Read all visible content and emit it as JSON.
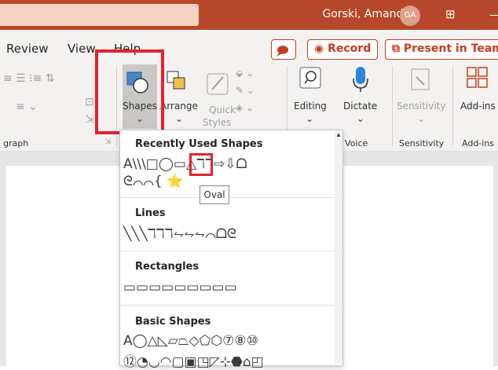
{
  "titlebar": {
    "user_name": "Gorski, Amanda",
    "avatar_initials": "GA",
    "accent": "#b7472a"
  },
  "menu": {
    "items": [
      "Review",
      "View",
      "Help"
    ],
    "record_label": "Record",
    "present_label": "Present in Teams"
  },
  "ribbon": {
    "group_paragraph": "graph",
    "shapes_label": "Shapes",
    "arrange_label": "Arrange",
    "quick_styles_label_1": "Quick",
    "quick_styles_label_2": "Styles",
    "editing_label": "Editing",
    "dictate_label": "Dictate",
    "sensitivity_label": "Sensitivity",
    "addins_label": "Add-ins",
    "group_voice": "Voice",
    "group_sensitivity": "Sensitivity",
    "group_addins": "Add-ins"
  },
  "dropdown": {
    "recent_header": "Recently Used Shapes",
    "recent_row_1": "A\\\\\\□◯▭△ℸℸ⇨⇩ᗝ",
    "recent_row_2": "ᘓ⌒⌒{ ⭐",
    "tooltip": "Oval",
    "lines_header": "Lines",
    "lines_row": "╲╲╲ℸℸℸ⥊⥊⥊⌒ᗝᘓ",
    "rectangles_header": "Rectangles",
    "rectangles_row": "▭▭▭▭▭▭▭▭▭",
    "basic_header": "Basic Shapes",
    "basic_row_1": "A◯△◺▱⏢◇⬠⬡⑦⑧⑩",
    "basic_row_2": "⑫◔◡◠▢▣◳◸⊹⬣⌂◰"
  }
}
